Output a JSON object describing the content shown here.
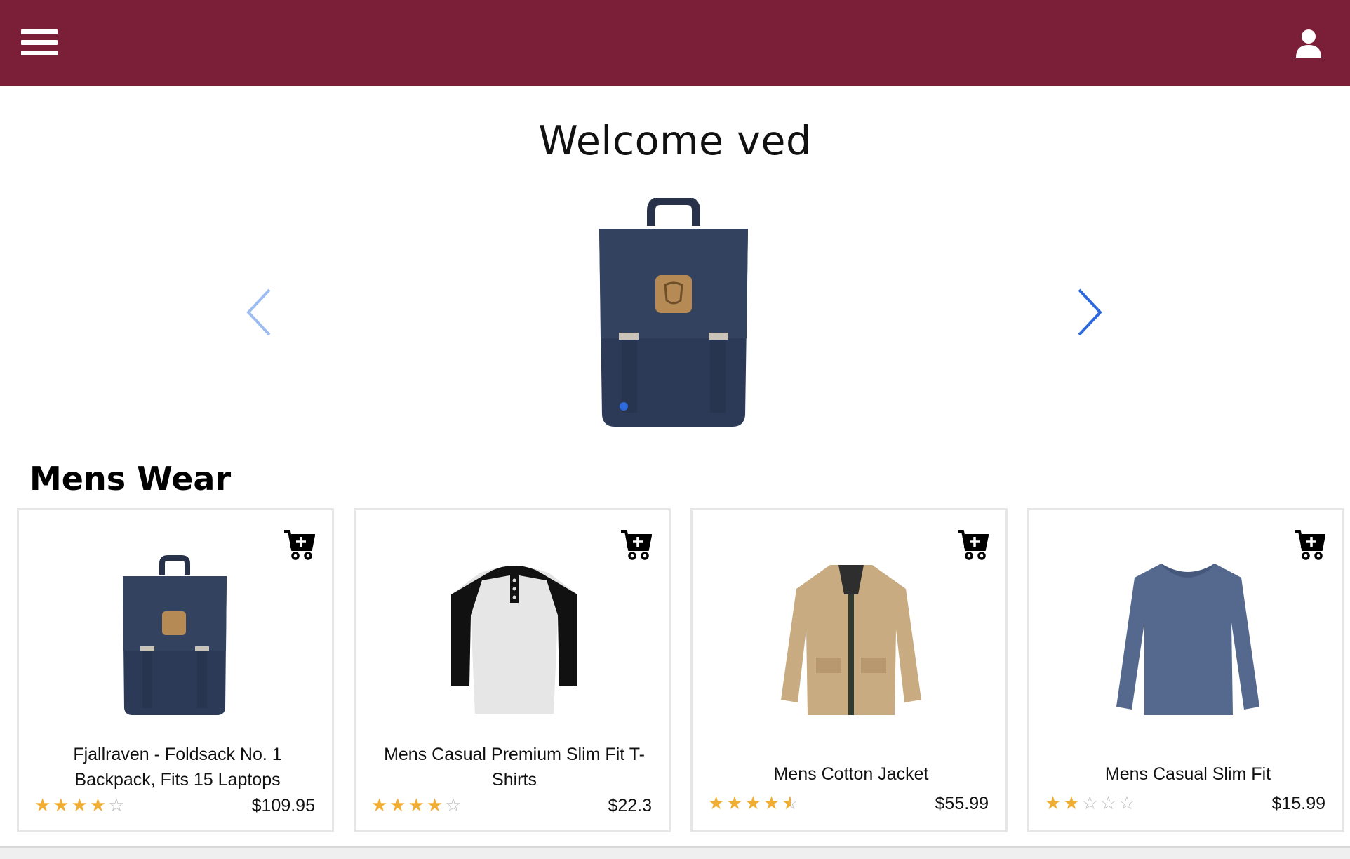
{
  "header": {
    "menu_icon": "hamburger-menu-icon",
    "user_icon": "user-icon",
    "colors": {
      "bar": "#7a1f37",
      "icon": "#ffffff"
    }
  },
  "welcome": {
    "text": "Welcome ved"
  },
  "carousel": {
    "prev_icon": "chevron-left-icon",
    "next_icon": "chevron-right-icon",
    "image": "backpack-image",
    "active_slide": 1,
    "colors": {
      "arrow": "#2d6ae0",
      "dot": "#2d6ae0"
    }
  },
  "section": {
    "title": "Mens Wear"
  },
  "products": [
    {
      "title": "Fjallraven - Foldsack No. 1 Backpack, Fits 15 Laptops",
      "price": "$109.95",
      "rating": 4,
      "image": "backpack-image",
      "cart_icon": "add-to-cart-icon"
    },
    {
      "title": "Mens Casual Premium Slim Fit T-Shirts",
      "price": "$22.3",
      "rating": 4,
      "image": "raglan-tshirt-image",
      "cart_icon": "add-to-cart-icon"
    },
    {
      "title": "Mens Cotton Jacket",
      "price": "$55.99",
      "rating": 4.5,
      "image": "cotton-jacket-image",
      "cart_icon": "add-to-cart-icon"
    },
    {
      "title": "Mens Casual Slim Fit",
      "price": "$15.99",
      "rating": 2,
      "image": "slim-fit-sweater-image",
      "cart_icon": "add-to-cart-icon"
    }
  ],
  "colors": {
    "star": "#f0ad32",
    "star_empty": "#b8b8b8"
  }
}
